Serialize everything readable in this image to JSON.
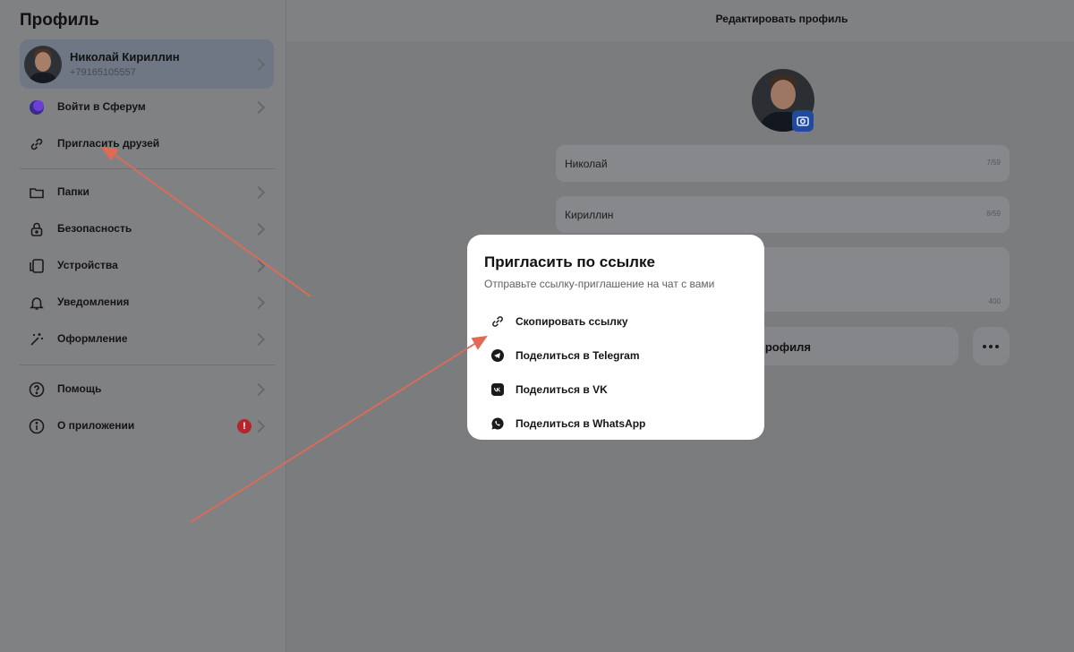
{
  "sidebar": {
    "title": "Профиль",
    "profile": {
      "name": "Николай Кириллин",
      "phone": "+79165105557"
    },
    "group1": [
      {
        "label": "Войти в Сферум",
        "icon": "sferum-logo-icon"
      },
      {
        "label": "Пригласить друзей",
        "icon": "link-icon"
      }
    ],
    "group2": [
      {
        "label": "Папки",
        "icon": "folder-icon"
      },
      {
        "label": "Безопасность",
        "icon": "lock-icon"
      },
      {
        "label": "Устройства",
        "icon": "devices-icon"
      },
      {
        "label": "Уведомления",
        "icon": "bell-icon"
      },
      {
        "label": "Оформление",
        "icon": "magic-wand-icon"
      }
    ],
    "group3": [
      {
        "label": "Помощь",
        "icon": "help-circle-icon"
      },
      {
        "label": "О приложении",
        "icon": "info-circle-icon",
        "badge": "!"
      }
    ]
  },
  "main": {
    "header_title": "Редактировать профиль",
    "first_name": {
      "value": "Николай",
      "counter": "7/59"
    },
    "last_name": {
      "value": "Кириллин",
      "counter": "8/59"
    },
    "about": {
      "value": "",
      "counter": "400"
    },
    "save_button_label": "профиля",
    "more_button_icon": "more-horizontal-icon"
  },
  "modal": {
    "title": "Пригласить по ссылке",
    "subtitle": "Отправьте ссылку-приглашение на чат с вами",
    "options": [
      {
        "label": "Скопировать ссылку",
        "icon": "link-icon"
      },
      {
        "label": "Поделиться в Telegram",
        "icon": "telegram-icon"
      },
      {
        "label": "Поделиться в VK",
        "icon": "vk-icon"
      },
      {
        "label": "Поделиться в WhatsApp",
        "icon": "whatsapp-icon"
      }
    ]
  },
  "colors": {
    "annotation_arrow": "#e06a55",
    "accent_blue": "#1f4aa0",
    "alert_red": "#b3262c",
    "overlay": "#7b7c7e"
  }
}
